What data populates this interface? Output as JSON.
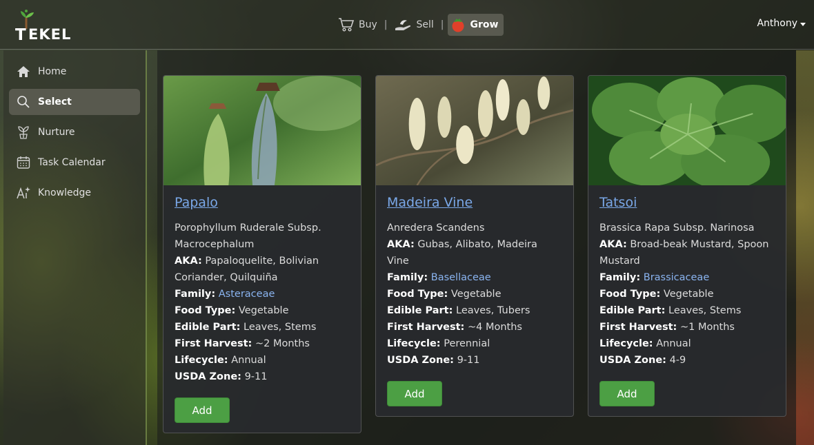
{
  "app": {
    "brand": "EKEL",
    "brand_initial": "T"
  },
  "topnav": {
    "items": [
      {
        "label": "Buy",
        "icon": "cart-icon"
      },
      {
        "label": "Sell",
        "icon": "hand-icon"
      },
      {
        "label": "Grow",
        "icon": "tomato-icon",
        "active": true
      }
    ],
    "separator": "|"
  },
  "user": {
    "name": "Anthony"
  },
  "sidebar": {
    "items": [
      {
        "label": "Home",
        "icon": "home-icon"
      },
      {
        "label": "Select",
        "icon": "search-icon",
        "active": true
      },
      {
        "label": "Nurture",
        "icon": "sprout-icon"
      },
      {
        "label": "Task Calendar",
        "icon": "calendar-icon"
      },
      {
        "label": "Knowledge",
        "icon": "ai-icon"
      }
    ]
  },
  "labels": {
    "aka": "AKA:",
    "family": "Family:",
    "food_type": "Food Type:",
    "edible_part": "Edible Part:",
    "first_harvest": "First Harvest:",
    "lifecycle": "Lifecycle:",
    "usda_zone": "USDA Zone:",
    "add": "Add"
  },
  "cards": [
    {
      "title": "Papalo",
      "scientific": "Porophyllum Ruderale Subsp. Macrocephalum",
      "aka": "Papaloquelite, Bolivian Coriander, Quilquiña",
      "family": "Asteraceae",
      "food_type": "Vegetable",
      "edible_part": "Leaves, Stems",
      "first_harvest": "~2 Months",
      "lifecycle": "Annual",
      "usda_zone": "9-11",
      "colors": {
        "bg": "#4e7a3a",
        "accent": "#9bc27a"
      }
    },
    {
      "title": "Madeira Vine",
      "scientific": "Anredera Scandens",
      "aka": "Gubas, Alibato, Madeira Vine",
      "family": "Basellaceae",
      "food_type": "Vegetable",
      "edible_part": "Leaves, Tubers",
      "first_harvest": "~4 Months",
      "lifecycle": "Perennial",
      "usda_zone": "9-11",
      "colors": {
        "bg": "#5a5a40",
        "accent": "#e8e3c2"
      }
    },
    {
      "title": "Tatsoi",
      "scientific": "Brassica Rapa Subsp. Narinosa",
      "aka": "Broad-beak Mustard, Spoon Mustard",
      "family": "Brassicaceae",
      "food_type": "Vegetable",
      "edible_part": "Leaves, Stems",
      "first_harvest": "~1 Months",
      "lifecycle": "Annual",
      "usda_zone": "4-9",
      "colors": {
        "bg": "#1f4a1c",
        "accent": "#6fa84e"
      }
    }
  ]
}
